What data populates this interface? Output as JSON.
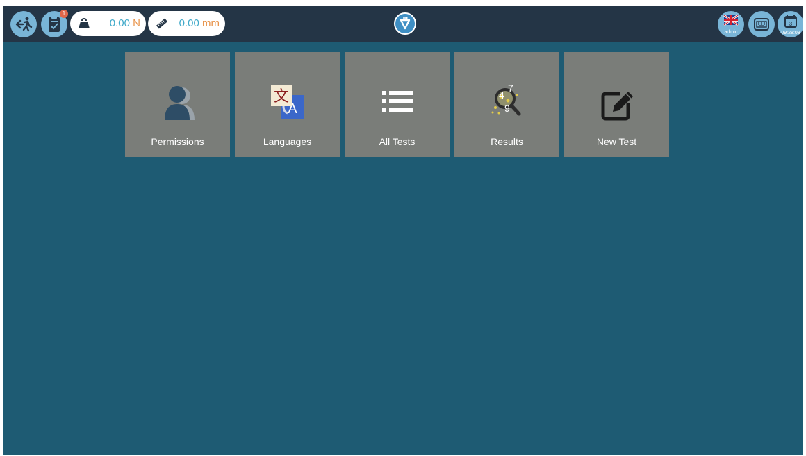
{
  "topbar": {
    "exit_icon": "exit-run-icon",
    "checklist_icon": "clipboard-check-icon",
    "notification_count": "1",
    "force": {
      "value": "0.00",
      "unit": "N",
      "icon": "weight-icon"
    },
    "position": {
      "value": "0.00",
      "unit": "mm",
      "icon": "ruler-icon"
    },
    "logo_icon": "logo-icon",
    "language": {
      "icon": "uk-flag-icon",
      "user": "admin"
    },
    "keyboard_icon": "keyboard-icon",
    "calendar": {
      "day": "3",
      "time": "09:28:08",
      "icon": "calendar-icon"
    }
  },
  "tiles": [
    {
      "label": "Permissions",
      "icon": "users-icon"
    },
    {
      "label": "Languages",
      "icon": "translate-icon"
    },
    {
      "label": "All Tests",
      "icon": "list-icon"
    },
    {
      "label": "Results",
      "icon": "search-results-icon"
    },
    {
      "label": "New Test",
      "icon": "edit-icon"
    }
  ],
  "results_digits": [
    "4",
    "7",
    "9"
  ],
  "colors": {
    "background": "#1e5b73",
    "topbar": "#243546",
    "tile": "#7a7d79",
    "button": "#79b5d7",
    "value": "#3fa9c9",
    "unit": "#e8934a"
  }
}
